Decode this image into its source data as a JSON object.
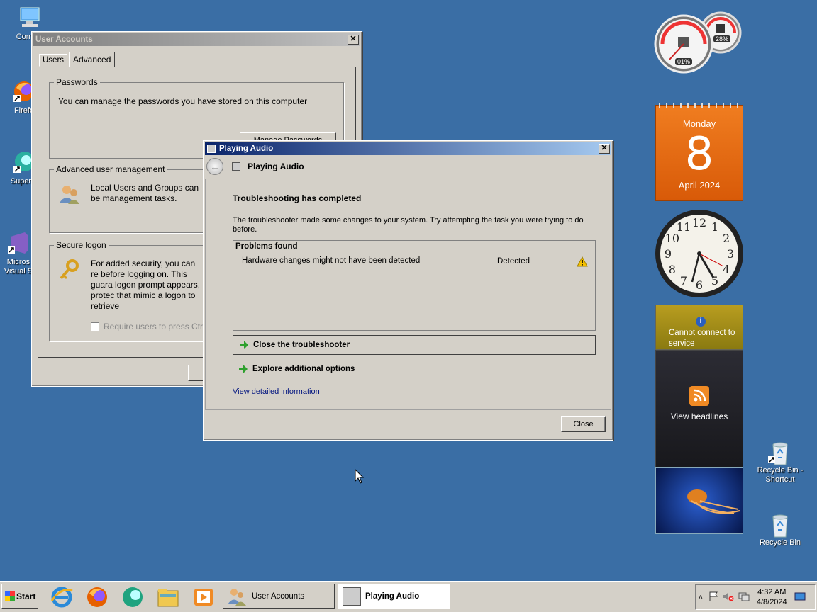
{
  "desktop": {
    "icons_left": [
      {
        "label": "Comput",
        "icon": "computer-icon"
      },
      {
        "label": "Firefo",
        "icon": "firefox-icon"
      },
      {
        "label": "Superm",
        "icon": "app-icon"
      },
      {
        "label": "Micros Visual S",
        "icon": "visual-studio-icon"
      }
    ],
    "icons_right": [
      {
        "label": "Recycle Bin - Shortcut",
        "icon": "recycle-bin-shortcut-icon"
      },
      {
        "label": "Recycle Bin",
        "icon": "recycle-bin-icon"
      }
    ]
  },
  "gadgets": {
    "cpu_meter": {
      "cpu": "01%",
      "memory": "28%"
    },
    "calendar": {
      "weekday": "Monday",
      "day": "8",
      "month_year": "April 2024"
    },
    "clock": {
      "numerals": [
        "12",
        "1",
        "2",
        "3",
        "4",
        "5",
        "6",
        "7",
        "8",
        "9",
        "10",
        "11"
      ]
    },
    "weather": {
      "message": "Cannot connect to service"
    },
    "feed": {
      "label": "View headlines"
    }
  },
  "user_accounts": {
    "title": "User Accounts",
    "tabs": [
      "Users",
      "Advanced"
    ],
    "passwords": {
      "legend": "Passwords",
      "text": "You can manage the passwords you have stored on this computer",
      "button": "Manage Passwords"
    },
    "advanced_mgmt": {
      "legend": "Advanced user management",
      "text": "Local Users and Groups can be management tasks."
    },
    "secure_logon": {
      "legend": "Secure logon",
      "text": "For added security, you can re before logging on. This guara logon prompt appears, protec that mimic a logon to retrieve",
      "checkbox": "Require users to press Ctrl-"
    }
  },
  "troubleshooter": {
    "title": "Playing Audio",
    "nav_title": "Playing Audio",
    "heading": "Troubleshooting has completed",
    "description": "The troubleshooter made some changes to your system. Try attempting the task you were trying to do before.",
    "problems_header": "Problems found",
    "problems": [
      {
        "name": "Hardware changes might not have been detected",
        "status": "Detected"
      }
    ],
    "option_close": "Close the troubleshooter",
    "option_explore": "Explore additional options",
    "detail_link": "View detailed information",
    "close_button": "Close"
  },
  "taskbar": {
    "start": "Start",
    "tasks": [
      "User Accounts",
      "Playing Audio"
    ],
    "time": "4:32 AM",
    "date": "4/8/2024"
  },
  "colors": {
    "desktop": "#3a6ea5",
    "calendar_orange": "#e86a10",
    "link": "#00137f",
    "warning": "#f5c000"
  }
}
